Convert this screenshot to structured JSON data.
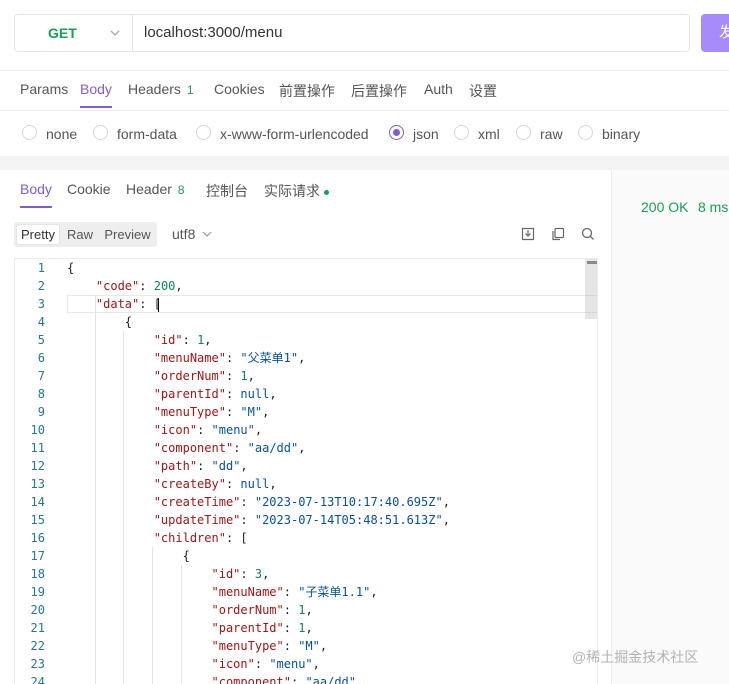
{
  "request": {
    "method": "GET",
    "url": "localhost:3000/menu",
    "send_label": "发"
  },
  "request_tabs": [
    {
      "label": "Params"
    },
    {
      "label": "Body"
    },
    {
      "label": "Headers",
      "count": "1"
    },
    {
      "label": "Cookies"
    },
    {
      "label": "前置操作"
    },
    {
      "label": "后置操作"
    },
    {
      "label": "Auth"
    },
    {
      "label": "设置"
    }
  ],
  "body_types": [
    "none",
    "form-data",
    "x-www-form-urlencoded",
    "json",
    "xml",
    "raw",
    "binary"
  ],
  "selected_body_type": "json",
  "response_tabs": [
    {
      "label": "Body"
    },
    {
      "label": "Cookie"
    },
    {
      "label": "Header",
      "count": "8"
    },
    {
      "label": "控制台"
    },
    {
      "label": "实际请求"
    }
  ],
  "view_modes": [
    "Pretty",
    "Raw",
    "Preview"
  ],
  "encoding": "utf8",
  "status": {
    "code_text": "200 OK",
    "time": "8 ms"
  },
  "code_lines": [
    "{",
    "    \"code\": 200,",
    "    \"data\": [",
    "        {",
    "            \"id\": 1,",
    "            \"menuName\": \"父菜单1\",",
    "            \"orderNum\": 1,",
    "            \"parentId\": null,",
    "            \"menuType\": \"M\",",
    "            \"icon\": \"menu\",",
    "            \"component\": \"aa/dd\",",
    "            \"path\": \"dd\",",
    "            \"createBy\": null,",
    "            \"createTime\": \"2023-07-13T10:17:40.695Z\",",
    "            \"updateTime\": \"2023-07-14T05:48:51.613Z\",",
    "            \"children\": [",
    "                {",
    "                    \"id\": 3,",
    "                    \"menuName\": \"子菜单1.1\",",
    "                    \"orderNum\": 1,",
    "                    \"parentId\": 1,",
    "                    \"menuType\": \"M\",",
    "                    \"icon\": \"menu\",",
    "                    \"component\": \"aa/dd\","
  ],
  "watermark": "@稀土掘金技术社区"
}
